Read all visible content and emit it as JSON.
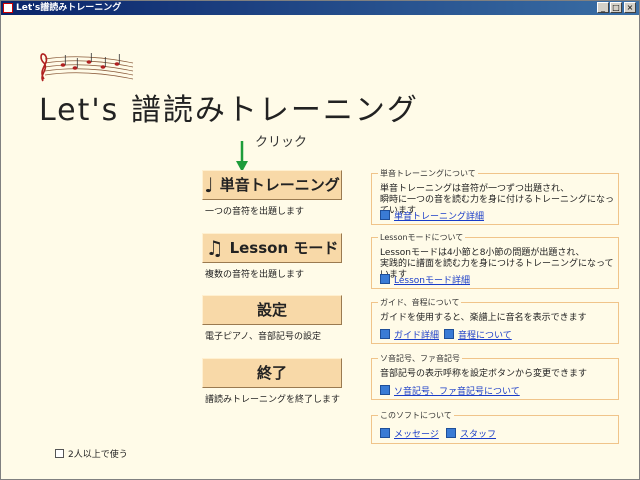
{
  "window": {
    "title": "Let's譜読みトレーニング"
  },
  "app_title": "Let's 譜読みトレーニング",
  "hint": {
    "text": "クリック"
  },
  "menu": [
    {
      "label": "単音トレーニング",
      "caption": "一つの音符を出題します",
      "icon": "quarter-note-icon"
    },
    {
      "label": "Lesson モード",
      "caption": "複数の音符を出題します",
      "icon": "eighth-notes-icon"
    },
    {
      "label": "設定",
      "caption": "電子ピアノ、音部記号の設定"
    },
    {
      "label": "終了",
      "caption": "譜読みトレーニングを終了します"
    }
  ],
  "panels": [
    {
      "title": "単音トレーニングについて",
      "lines": [
        "単音トレーニングは音符が一つずつ出題され、",
        "瞬時に一つの音を読む力を身に付けるトレーニングになっています"
      ],
      "links": [
        "単音トレーニング詳細"
      ]
    },
    {
      "title": "Lessonモードについて",
      "lines": [
        "Lessonモードは4小節と8小節の問題が出題され、",
        "実践的に譜面を読む力を身につけるトレーニングになっています"
      ],
      "links": [
        "Lessonモード詳細"
      ]
    },
    {
      "title": "ガイド、音程について",
      "lines": [
        "ガイドを使用すると、楽譜上に音名を表示できます"
      ],
      "links": [
        "ガイド詳細",
        "音程について"
      ]
    },
    {
      "title": "ソ音記号、ファ音記号",
      "lines": [
        "音部記号の表示呼称を設定ボタンから変更できます"
      ],
      "links": [
        "ソ音記号、ファ音記号について"
      ]
    },
    {
      "title": "このソフトについて",
      "lines": [],
      "links": [
        "メッセージ",
        "スタッフ"
      ]
    }
  ],
  "checkbox": {
    "label": "2人以上で使う",
    "checked": false
  },
  "colors": {
    "background": "#fffbe8",
    "button": "#f8d9a8",
    "panel_border": "#f0c48a",
    "link": "#1a3cc8",
    "arrow": "#1e9c3a"
  }
}
